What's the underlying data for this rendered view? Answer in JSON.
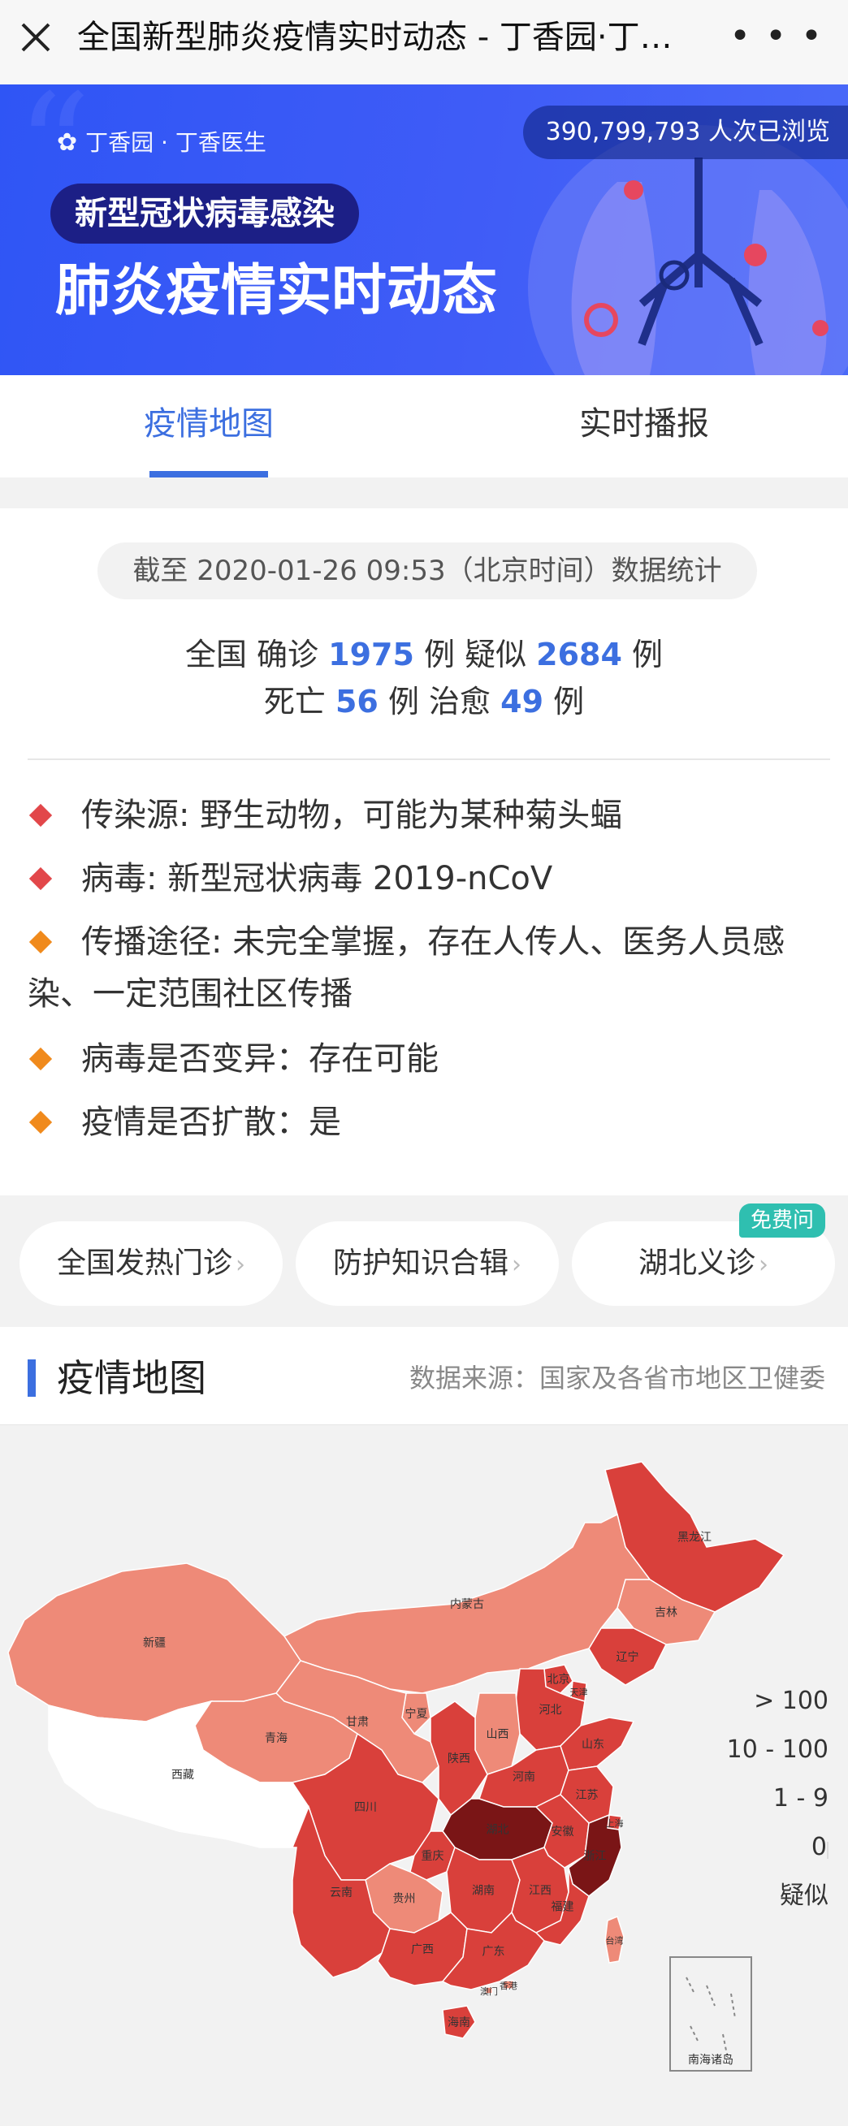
{
  "topbar": {
    "title": "全国新型肺炎疫情实时动态 - 丁香园·丁…",
    "close_icon": "close-icon",
    "more_icon": "more-icon"
  },
  "banner": {
    "views": "390,799,793 人次已浏览",
    "brand": "丁香园 · 丁香医生",
    "pill": "新型冠状病毒感染",
    "headline": "肺炎疫情实时动态"
  },
  "tabs": [
    {
      "label": "疫情地图",
      "active": true
    },
    {
      "label": "实时播报",
      "active": false
    }
  ],
  "summary": {
    "asof": "截至 2020-01-26 09:53（北京时间）数据统计",
    "line1": {
      "prefix": "全国 确诊 ",
      "confirmed": "1975",
      "mid": " 例 疑似 ",
      "suspected": "2684",
      "suffix": " 例"
    },
    "line2": {
      "prefix": "死亡 ",
      "deaths": "56",
      "mid": " 例 治愈 ",
      "cured": "49",
      "suffix": " 例"
    }
  },
  "info": [
    {
      "text": "传染源: 野生动物，可能为某种菊头蝠",
      "color": "#e2474a"
    },
    {
      "text": "病毒: 新型冠状病毒 2019-nCoV",
      "color": "#e2474a"
    },
    {
      "text": "传播途径: 未完全掌握，存在人传人、医务人员感染、一定范围社区传播",
      "color": "#f08a1c"
    },
    {
      "text": "病毒是否变异：存在可能",
      "color": "#f08a1c"
    },
    {
      "text": "疫情是否扩散：是",
      "color": "#f08a1c"
    }
  ],
  "links": [
    {
      "label": "全国发热门诊"
    },
    {
      "label": "防护知识合辑"
    },
    {
      "label": "湖北义诊",
      "tag": "免费问"
    }
  ],
  "section": {
    "title": "疫情地图",
    "source": "数据来源：国家及各省市地区卫健委"
  },
  "map": {
    "legend": [
      {
        "label": "> 100",
        "color": "#7a1516"
      },
      {
        "label": "10 - 100",
        "color": "#d9403b"
      },
      {
        "label": "1 - 9",
        "color": "#ee8a78"
      },
      {
        "label": "0",
        "color": "#ffffff"
      },
      {
        "label": "疑似",
        "color": "#f7d99c"
      }
    ],
    "provinces": [
      {
        "name": "黑龙江",
        "cat": "mid"
      },
      {
        "name": "吉林",
        "cat": "low"
      },
      {
        "name": "辽宁",
        "cat": "mid"
      },
      {
        "name": "内蒙古",
        "cat": "low"
      },
      {
        "name": "新疆",
        "cat": "low"
      },
      {
        "name": "北京",
        "cat": "mid"
      },
      {
        "name": "天津",
        "cat": "mid"
      },
      {
        "name": "河北",
        "cat": "mid"
      },
      {
        "name": "宁夏",
        "cat": "low"
      },
      {
        "name": "山西",
        "cat": "low"
      },
      {
        "name": "山东",
        "cat": "mid"
      },
      {
        "name": "甘肃",
        "cat": "low"
      },
      {
        "name": "青海",
        "cat": "low"
      },
      {
        "name": "陕西",
        "cat": "mid"
      },
      {
        "name": "河南",
        "cat": "mid"
      },
      {
        "name": "江苏",
        "cat": "mid"
      },
      {
        "name": "西藏",
        "cat": "zero"
      },
      {
        "name": "四川",
        "cat": "mid"
      },
      {
        "name": "湖北",
        "cat": "high"
      },
      {
        "name": "安徽",
        "cat": "mid"
      },
      {
        "name": "上海",
        "cat": "mid"
      },
      {
        "name": "重庆",
        "cat": "mid"
      },
      {
        "name": "浙江",
        "cat": "high"
      },
      {
        "name": "贵州",
        "cat": "low"
      },
      {
        "name": "湖南",
        "cat": "mid"
      },
      {
        "name": "江西",
        "cat": "mid"
      },
      {
        "name": "福建",
        "cat": "mid"
      },
      {
        "name": "台湾",
        "cat": "low"
      },
      {
        "name": "云南",
        "cat": "mid"
      },
      {
        "name": "广西",
        "cat": "mid"
      },
      {
        "name": "广东",
        "cat": "mid"
      },
      {
        "name": "澳门",
        "cat": "low"
      },
      {
        "name": "香港",
        "cat": "low"
      },
      {
        "name": "海南",
        "cat": "mid"
      }
    ],
    "inset_label": "南海诸岛"
  }
}
